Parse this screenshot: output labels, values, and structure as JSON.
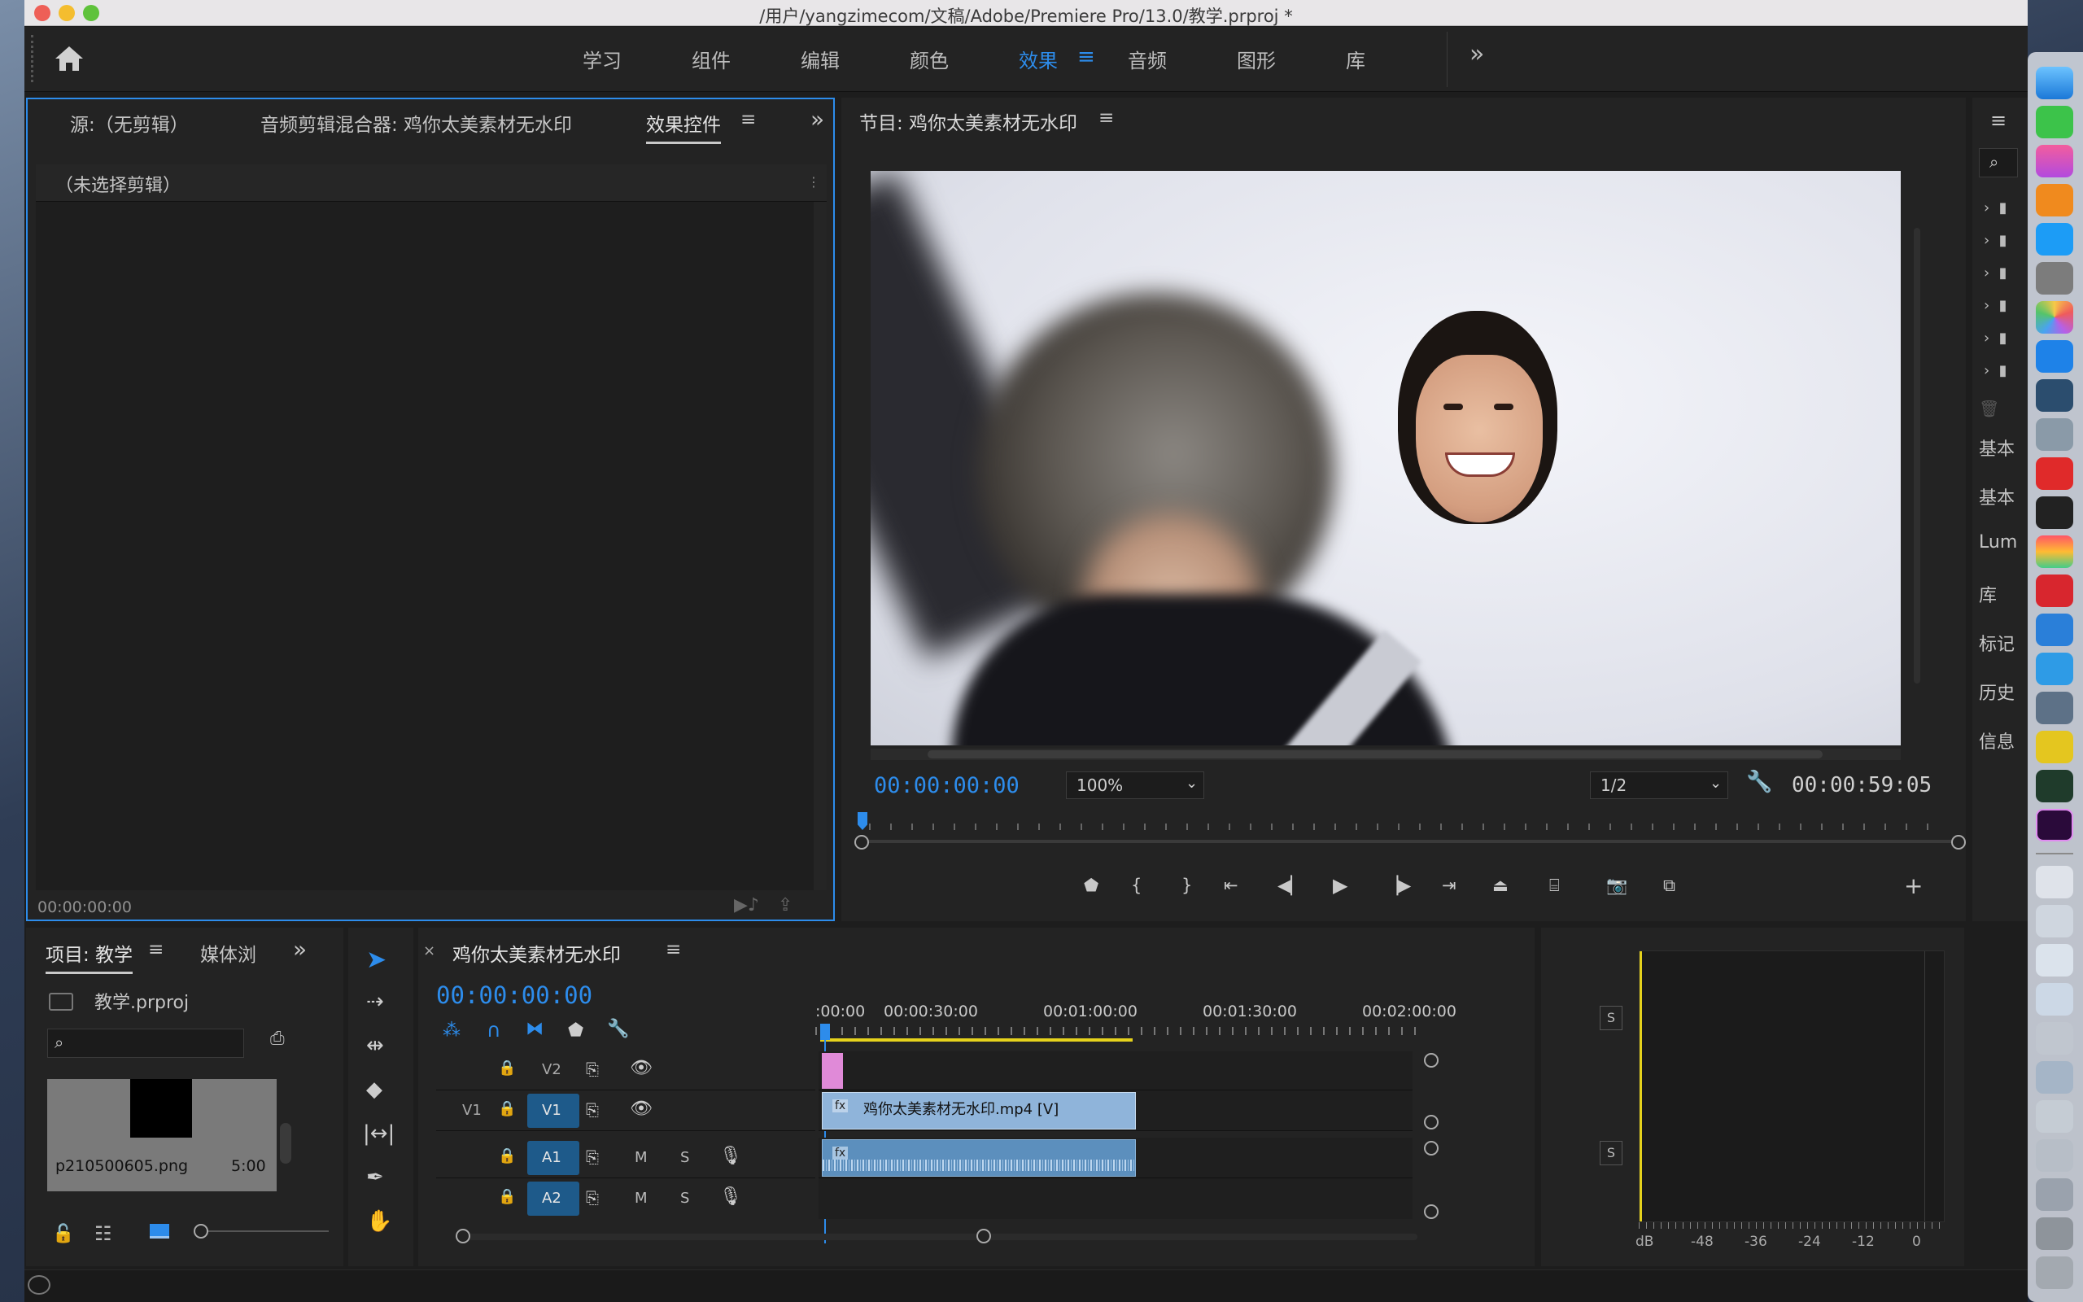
{
  "window": {
    "title": "/用户/yangzimecom/文稿/Adobe/Premiere Pro/13.0/教学.prproj *"
  },
  "workspaces": [
    "学习",
    "组件",
    "编辑",
    "颜色",
    "效果",
    "音频",
    "图形",
    "库"
  ],
  "active_workspace": "效果",
  "source": {
    "tabs": {
      "source": "源:（无剪辑）",
      "mixer": "音频剪辑混合器: 鸡你太美素材无水印",
      "effects": "效果控件"
    },
    "empty_label": "（未选择剪辑）",
    "timecode": "00:00:00:00"
  },
  "program": {
    "title": "节目: 鸡你太美素材无水印",
    "timecode": "00:00:00:00",
    "zoom": "100%",
    "quality": "1/2",
    "duration": "00:00:59:05"
  },
  "right_panel": {
    "items": [
      "基本",
      "基本",
      "Lum",
      "库",
      "标记",
      "历史",
      "信息"
    ]
  },
  "project": {
    "tabs": {
      "project": "项目: 教学",
      "media": "媒体浏"
    },
    "file": "教学.prproj",
    "clip_name": "p210500605.png",
    "clip_duration": "5:00"
  },
  "timeline": {
    "title": "鸡你太美素材无水印",
    "timecode": "00:00:00:00",
    "ruler": [
      ":00:00",
      "00:00:30:00",
      "00:01:00:00",
      "00:01:30:00",
      "00:02:00:00"
    ],
    "tracks": [
      {
        "label": "V2",
        "toggle": ""
      },
      {
        "label": "V1",
        "toggle": "V1"
      },
      {
        "label": "A1",
        "toggle": "",
        "m": "M",
        "s": "S"
      },
      {
        "label": "A2",
        "toggle": "",
        "m": "M",
        "s": "S"
      }
    ],
    "clip_label": "鸡你太美素材无水印.mp4 [V]",
    "fx": "fx"
  },
  "meter": {
    "solo": "S",
    "scale": [
      "dB",
      "-48",
      "-36",
      "-24",
      "-12",
      "0"
    ]
  }
}
